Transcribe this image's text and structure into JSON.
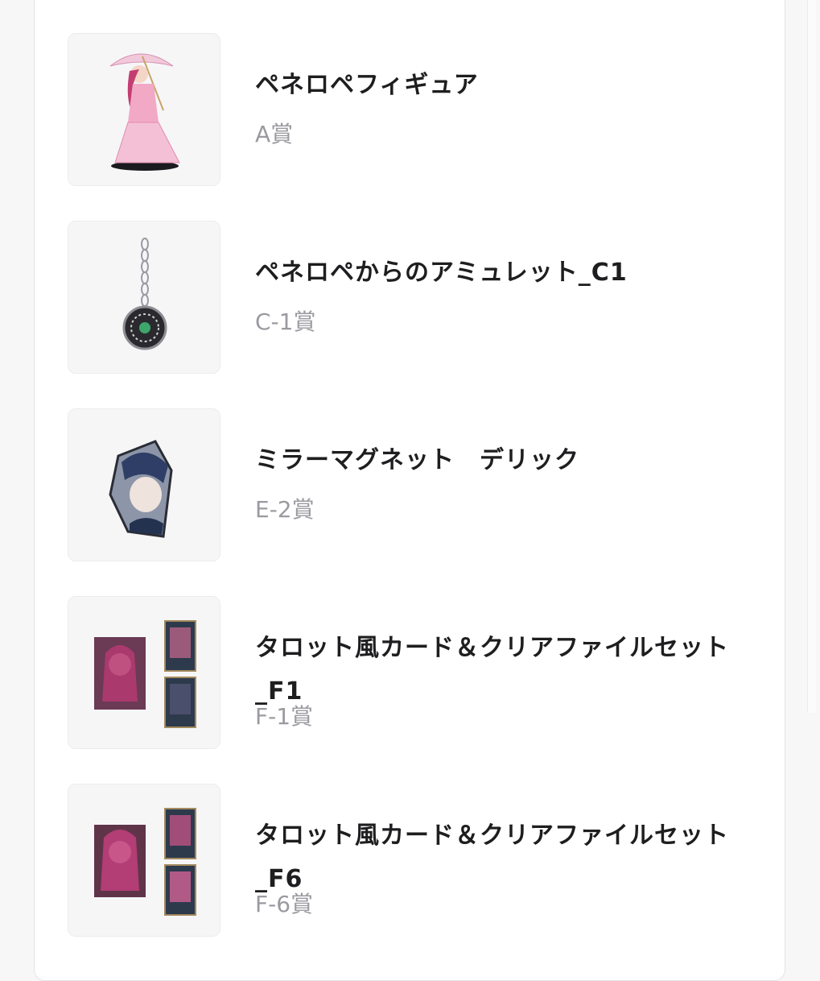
{
  "items": [
    {
      "name": "ペネロペフィギュア",
      "prize": "A賞",
      "image_icon": "figure-image"
    },
    {
      "name": "ペネロペからのアミュレット_C1",
      "prize": "C-1賞",
      "image_icon": "amulet-image"
    },
    {
      "name": "ミラーマグネット　デリック",
      "prize": "E-2賞",
      "image_icon": "mirror-magnet-image"
    },
    {
      "name": "タロット風カード＆クリアファイルセット_F1",
      "prize": "F-1賞",
      "image_icon": "tarot-card-set-image"
    },
    {
      "name": "タロット風カード＆クリアファイルセット_F6",
      "prize": "F-6賞",
      "image_icon": "tarot-card-set-image"
    }
  ],
  "colors": {
    "title": "#1e1e20",
    "prize": "#9a9aa0",
    "thumb_bg": "#f6f6f7",
    "accent_pink": "#e07aa6"
  }
}
